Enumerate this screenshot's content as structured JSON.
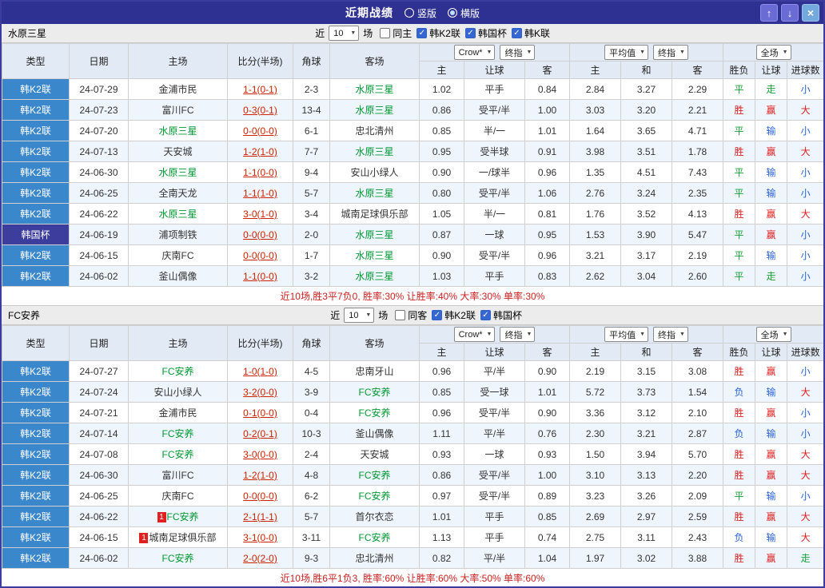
{
  "title_bar": {
    "title": "近期战绩",
    "radios": [
      {
        "label": "竖版",
        "selected": false
      },
      {
        "label": "横版",
        "selected": true
      }
    ],
    "buttons": {
      "up": "↑",
      "down": "↓",
      "close": "×"
    }
  },
  "columns": [
    "类型",
    "日期",
    "主场",
    "比分(半场)",
    "角球",
    "客场",
    "主",
    "让球",
    "客",
    "主",
    "和",
    "客",
    "胜负",
    "让球",
    "进球数"
  ],
  "header_controls": {
    "bookmaker": "Crow*",
    "final_index": "终指",
    "average": "平均值",
    "scope_full": "全场"
  },
  "colors": {
    "frame-border": "#3c3c9c",
    "titlebar-bg": "#2e3192",
    "header-bg": "#e2ebf5",
    "row-alt-bg": "#eef5fc",
    "league-k2-bg": "#3a87cc",
    "league-cup-bg": "#3d3d9e",
    "focus-team": "#009933",
    "score": "#cc2200",
    "res-win": "#e02020",
    "res-draw": "#18a038",
    "res-lose": "#2962d9",
    "summary": "#cc2020"
  },
  "sections": [
    {
      "team": "水原三星",
      "filter": {
        "near_label": "近",
        "count": "10",
        "games_label": "场",
        "same": {
          "label": "同主",
          "checked": false
        },
        "leagues": [
          {
            "label": "韩K2联",
            "checked": true
          },
          {
            "label": "韩国杯",
            "checked": true
          },
          {
            "label": "韩K联",
            "checked": true
          }
        ]
      },
      "rows": [
        {
          "lg": "韩K2联",
          "date": "24-07-29",
          "home": "金浦市民",
          "score": "1-1(0-1)",
          "corner": "2-3",
          "away": "水原三星",
          "af": true,
          "a1": "1.02",
          "line": "平手",
          "a2": "0.84",
          "h": "2.84",
          "d": "3.27",
          "a": "2.29",
          "r1": "平",
          "r2": "走",
          "r3": "小"
        },
        {
          "lg": "韩K2联",
          "date": "24-07-23",
          "home": "富川FC",
          "score": "0-3(0-1)",
          "corner": "13-4",
          "away": "水原三星",
          "af": true,
          "a1": "0.86",
          "line": "受平/半",
          "a2": "1.00",
          "h": "3.03",
          "d": "3.20",
          "a": "2.21",
          "r1": "胜",
          "r2": "赢",
          "r3": "大"
        },
        {
          "lg": "韩K2联",
          "date": "24-07-20",
          "home": "水原三星",
          "hf": true,
          "score": "0-0(0-0)",
          "corner": "6-1",
          "away": "忠北清州",
          "a1": "0.85",
          "line": "半/一",
          "a2": "1.01",
          "h": "1.64",
          "d": "3.65",
          "a": "4.71",
          "r1": "平",
          "r2": "输",
          "r3": "小"
        },
        {
          "lg": "韩K2联",
          "date": "24-07-13",
          "home": "天安城",
          "score": "1-2(1-0)",
          "corner": "7-7",
          "away": "水原三星",
          "af": true,
          "a1": "0.95",
          "line": "受半球",
          "a2": "0.91",
          "h": "3.98",
          "d": "3.51",
          "a": "1.78",
          "r1": "胜",
          "r2": "赢",
          "r3": "大"
        },
        {
          "lg": "韩K2联",
          "date": "24-06-30",
          "home": "水原三星",
          "hf": true,
          "score": "1-1(0-0)",
          "corner": "9-4",
          "away": "安山小绿人",
          "a1": "0.90",
          "line": "一/球半",
          "a2": "0.96",
          "h": "1.35",
          "d": "4.51",
          "a": "7.43",
          "r1": "平",
          "r2": "输",
          "r3": "小"
        },
        {
          "lg": "韩K2联",
          "date": "24-06-25",
          "home": "全南天龙",
          "score": "1-1(1-0)",
          "corner": "5-7",
          "away": "水原三星",
          "af": true,
          "a1": "0.80",
          "line": "受平/半",
          "a2": "1.06",
          "h": "2.76",
          "d": "3.24",
          "a": "2.35",
          "r1": "平",
          "r2": "输",
          "r3": "小"
        },
        {
          "lg": "韩K2联",
          "date": "24-06-22",
          "home": "水原三星",
          "hf": true,
          "score": "3-0(1-0)",
          "corner": "3-4",
          "away": "城南足球俱乐部",
          "a1": "1.05",
          "line": "半/一",
          "a2": "0.81",
          "h": "1.76",
          "d": "3.52",
          "a": "4.13",
          "r1": "胜",
          "r2": "赢",
          "r3": "大"
        },
        {
          "lg": "韩国杯",
          "cup": true,
          "date": "24-06-19",
          "home": "浦项制铁",
          "score": "0-0(0-0)",
          "corner": "2-0",
          "away": "水原三星",
          "af": true,
          "a1": "0.87",
          "line": "一球",
          "a2": "0.95",
          "h": "1.53",
          "d": "3.90",
          "a": "5.47",
          "r1": "平",
          "r2": "赢",
          "r3": "小"
        },
        {
          "lg": "韩K2联",
          "date": "24-06-15",
          "home": "庆南FC",
          "score": "0-0(0-0)",
          "corner": "1-7",
          "away": "水原三星",
          "af": true,
          "a1": "0.90",
          "line": "受平/半",
          "a2": "0.96",
          "h": "3.21",
          "d": "3.17",
          "a": "2.19",
          "r1": "平",
          "r2": "输",
          "r3": "小"
        },
        {
          "lg": "韩K2联",
          "date": "24-06-02",
          "home": "釜山偶像",
          "score": "1-1(0-0)",
          "corner": "3-2",
          "away": "水原三星",
          "af": true,
          "a1": "1.03",
          "line": "平手",
          "a2": "0.83",
          "h": "2.62",
          "d": "3.04",
          "a": "2.60",
          "r1": "平",
          "r2": "走",
          "r3": "小"
        }
      ],
      "summary": "近10场,胜3平7负0, 胜率:30% 让胜率:40% 大率:30% 单率:30%"
    },
    {
      "team": "FC安养",
      "filter": {
        "near_label": "近",
        "count": "10",
        "games_label": "场",
        "same": {
          "label": "同客",
          "checked": false
        },
        "leagues": [
          {
            "label": "韩K2联",
            "checked": true
          },
          {
            "label": "韩国杯",
            "checked": true
          }
        ]
      },
      "rows": [
        {
          "lg": "韩K2联",
          "date": "24-07-27",
          "home": "FC安养",
          "hf": true,
          "score": "1-0(1-0)",
          "corner": "4-5",
          "away": "忠南牙山",
          "a1": "0.96",
          "line": "平/半",
          "a2": "0.90",
          "h": "2.19",
          "d": "3.15",
          "a": "3.08",
          "r1": "胜",
          "r2": "赢",
          "r3": "小"
        },
        {
          "lg": "韩K2联",
          "date": "24-07-24",
          "home": "安山小绿人",
          "score": "3-2(0-0)",
          "corner": "3-9",
          "away": "FC安养",
          "af": true,
          "a1": "0.85",
          "line": "受一球",
          "a2": "1.01",
          "h": "5.72",
          "d": "3.73",
          "a": "1.54",
          "r1": "负",
          "r2": "输",
          "r3": "大"
        },
        {
          "lg": "韩K2联",
          "date": "24-07-21",
          "home": "金浦市民",
          "score": "0-1(0-0)",
          "corner": "0-4",
          "away": "FC安养",
          "af": true,
          "a1": "0.96",
          "line": "受平/半",
          "a2": "0.90",
          "h": "3.36",
          "d": "3.12",
          "a": "2.10",
          "r1": "胜",
          "r2": "赢",
          "r3": "小"
        },
        {
          "lg": "韩K2联",
          "date": "24-07-14",
          "home": "FC安养",
          "hf": true,
          "score": "0-2(0-1)",
          "corner": "10-3",
          "away": "釜山偶像",
          "a1": "1.11",
          "line": "平/半",
          "a2": "0.76",
          "h": "2.30",
          "d": "3.21",
          "a": "2.87",
          "r1": "负",
          "r2": "输",
          "r3": "小"
        },
        {
          "lg": "韩K2联",
          "date": "24-07-08",
          "home": "FC安养",
          "hf": true,
          "score": "3-0(0-0)",
          "corner": "2-4",
          "away": "天安城",
          "a1": "0.93",
          "line": "一球",
          "a2": "0.93",
          "h": "1.50",
          "d": "3.94",
          "a": "5.70",
          "r1": "胜",
          "r2": "赢",
          "r3": "大"
        },
        {
          "lg": "韩K2联",
          "date": "24-06-30",
          "home": "富川FC",
          "score": "1-2(1-0)",
          "corner": "4-8",
          "away": "FC安养",
          "af": true,
          "a1": "0.86",
          "line": "受平/半",
          "a2": "1.00",
          "h": "3.10",
          "d": "3.13",
          "a": "2.20",
          "r1": "胜",
          "r2": "赢",
          "r3": "大"
        },
        {
          "lg": "韩K2联",
          "date": "24-06-25",
          "home": "庆南FC",
          "score": "0-0(0-0)",
          "corner": "6-2",
          "away": "FC安养",
          "af": true,
          "a1": "0.97",
          "line": "受平/半",
          "a2": "0.89",
          "h": "3.23",
          "d": "3.26",
          "a": "2.09",
          "r1": "平",
          "r2": "输",
          "r3": "小"
        },
        {
          "lg": "韩K2联",
          "date": "24-06-22",
          "home": "FC安养",
          "hf": true,
          "hb": "1",
          "score": "2-1(1-1)",
          "corner": "5-7",
          "away": "首尔衣恋",
          "a1": "1.01",
          "line": "平手",
          "a2": "0.85",
          "h": "2.69",
          "d": "2.97",
          "a": "2.59",
          "r1": "胜",
          "r2": "赢",
          "r3": "大"
        },
        {
          "lg": "韩K2联",
          "date": "24-06-15",
          "home": "城南足球俱乐部",
          "hb": "1",
          "score": "3-1(0-0)",
          "corner": "3-11",
          "away": "FC安养",
          "af": true,
          "a1": "1.13",
          "line": "平手",
          "a2": "0.74",
          "h": "2.75",
          "d": "3.11",
          "a": "2.43",
          "r1": "负",
          "r2": "输",
          "r3": "大"
        },
        {
          "lg": "韩K2联",
          "date": "24-06-02",
          "home": "FC安养",
          "hf": true,
          "score": "2-0(2-0)",
          "corner": "9-3",
          "away": "忠北清州",
          "a1": "0.82",
          "line": "平/半",
          "a2": "1.04",
          "h": "1.97",
          "d": "3.02",
          "a": "3.88",
          "r1": "胜",
          "r2": "赢",
          "r3": "走"
        }
      ],
      "summary": "近10场,胜6平1负3, 胜率:60% 让胜率:60% 大率:50% 单率:60%"
    }
  ]
}
